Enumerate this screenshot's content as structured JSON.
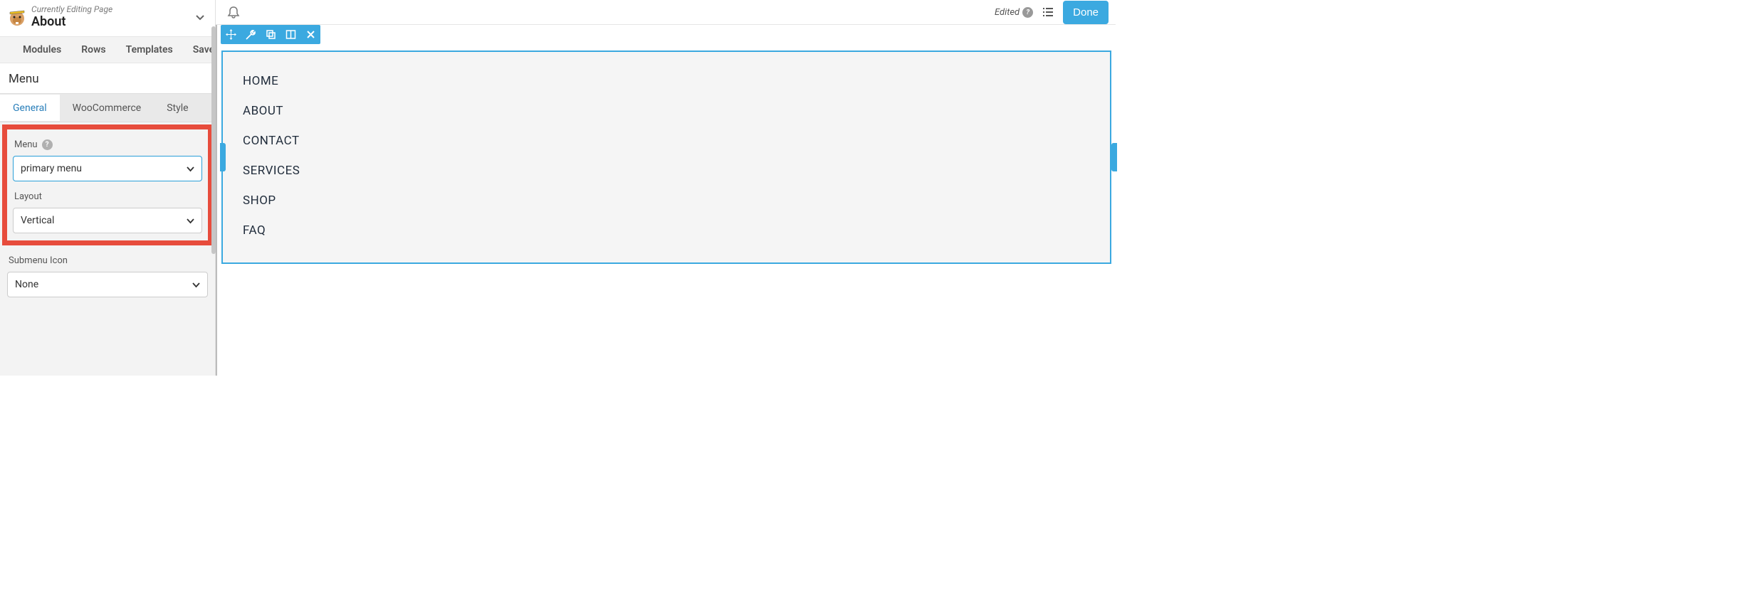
{
  "header": {
    "subtitle": "Currently Editing Page",
    "title": "About"
  },
  "main_tabs": [
    "Modules",
    "Rows",
    "Templates",
    "Saved"
  ],
  "section_title": "Menu",
  "sub_tabs": [
    "General",
    "WooCommerce",
    "Style"
  ],
  "fields": {
    "menu": {
      "label": "Menu",
      "value": "primary menu"
    },
    "layout": {
      "label": "Layout",
      "value": "Vertical"
    },
    "submenu_icon": {
      "label": "Submenu Icon",
      "value": "None"
    }
  },
  "topbar": {
    "edited_label": "Edited",
    "done_label": "Done"
  },
  "menu_items": [
    "HOME",
    "ABOUT",
    "CONTACT",
    "SERVICES",
    "SHOP",
    "FAQ"
  ],
  "toolbar_icons": [
    "move-icon",
    "wrench-icon",
    "duplicate-icon",
    "columns-icon",
    "close-icon"
  ]
}
